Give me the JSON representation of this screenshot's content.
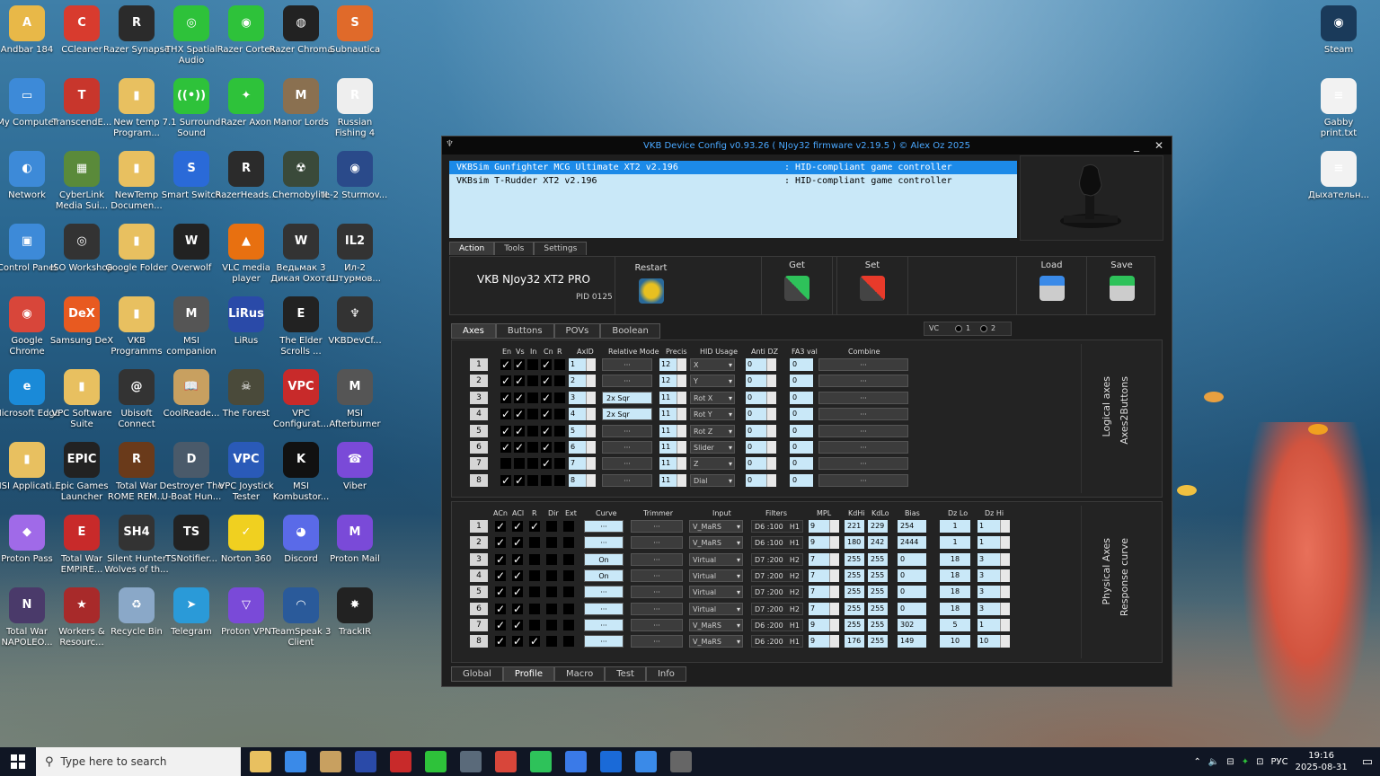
{
  "desktop": {
    "icons": [
      {
        "label": "Andbar 184",
        "color": "#e8b848",
        "glyph": "A"
      },
      {
        "label": "CCleaner",
        "color": "#d83b2e",
        "glyph": "C"
      },
      {
        "label": "Razer Synapse",
        "color": "#2b2b2b",
        "glyph": "R"
      },
      {
        "label": "THX Spatial Audio",
        "color": "#2ec23a",
        "glyph": "◎"
      },
      {
        "label": "Razer Cortex",
        "color": "#2ec23a",
        "glyph": "◉"
      },
      {
        "label": "Razer Chroma",
        "color": "#222",
        "glyph": "◍"
      },
      {
        "label": "Subnautica",
        "color": "#e06a2a",
        "glyph": "S"
      },
      {
        "label": "My Computer",
        "color": "#3d8ad8",
        "glyph": "▭"
      },
      {
        "label": "TranscendE...",
        "color": "#c8362c",
        "glyph": "T"
      },
      {
        "label": "New temp Program...",
        "color": "#e8c060",
        "glyph": "▮"
      },
      {
        "label": "7.1 Surround Sound",
        "color": "#2ec23a",
        "glyph": "((•))"
      },
      {
        "label": "Razer Axon",
        "color": "#2ec23a",
        "glyph": "✦"
      },
      {
        "label": "Manor Lords",
        "color": "#8a7050",
        "glyph": "M"
      },
      {
        "label": "Russian Fishing 4",
        "color": "#eee",
        "glyph": "R"
      },
      {
        "label": "Network",
        "color": "#3d8ad8",
        "glyph": "◐"
      },
      {
        "label": "CyberLink Media Sui...",
        "color": "#5a8a3a",
        "glyph": "▦"
      },
      {
        "label": "NewTemp Documen...",
        "color": "#e8c060",
        "glyph": "▮"
      },
      {
        "label": "Smart Switch",
        "color": "#2a6ad8",
        "glyph": "S"
      },
      {
        "label": "RazerHeads...",
        "color": "#2b2b2b",
        "glyph": "R"
      },
      {
        "label": "Chernobylite",
        "color": "#3a4a3a",
        "glyph": "☢"
      },
      {
        "label": "IL-2 Sturmov...",
        "color": "#2a4a8a",
        "glyph": "◉"
      },
      {
        "label": "Control Panel",
        "color": "#3d8ad8",
        "glyph": "▣"
      },
      {
        "label": "ISO Workshop",
        "color": "#333",
        "glyph": "◎"
      },
      {
        "label": "Google Folder",
        "color": "#e8c060",
        "glyph": "▮"
      },
      {
        "label": "Overwolf",
        "color": "#222",
        "glyph": "W"
      },
      {
        "label": "VLC media player",
        "color": "#e87010",
        "glyph": "▲"
      },
      {
        "label": "Ведьмак 3 Дикая Охота",
        "color": "#333",
        "glyph": "W"
      },
      {
        "label": "Ил-2 Штурмов...",
        "color": "#333",
        "glyph": "IL2"
      },
      {
        "label": "Google Chrome",
        "color": "#d8463a",
        "glyph": "◉"
      },
      {
        "label": "Samsung DeX",
        "color": "#e85a20",
        "glyph": "DeX"
      },
      {
        "label": "VKB Programms",
        "color": "#e8c060",
        "glyph": "▮"
      },
      {
        "label": "MSI companion",
        "color": "#555",
        "glyph": "M"
      },
      {
        "label": "LiRus",
        "color": "#2a4aa8",
        "glyph": "LiRus"
      },
      {
        "label": "The Elder Scrolls ...",
        "color": "#222",
        "glyph": "E"
      },
      {
        "label": "VKBDevCf...",
        "color": "#333",
        "glyph": "♆"
      },
      {
        "label": "Microsoft Edge",
        "color": "#1a8ad8",
        "glyph": "e"
      },
      {
        "label": "VPC Software Suite",
        "color": "#e8c060",
        "glyph": "▮"
      },
      {
        "label": "Ubisoft Connect",
        "color": "#333",
        "glyph": "@"
      },
      {
        "label": "CoolReade...",
        "color": "#c8a060",
        "glyph": "📖"
      },
      {
        "label": "The Forest",
        "color": "#4a4a3a",
        "glyph": "☠"
      },
      {
        "label": "VPC Configurat...",
        "color": "#c82a2a",
        "glyph": "VPC"
      },
      {
        "label": "MSI Afterburner",
        "color": "#555",
        "glyph": "M"
      },
      {
        "label": "MSI Applicati...",
        "color": "#e8c060",
        "glyph": "▮"
      },
      {
        "label": "Epic Games Launcher",
        "color": "#222",
        "glyph": "EPIC"
      },
      {
        "label": "Total War ROME REM...",
        "color": "#6a3a1a",
        "glyph": "R"
      },
      {
        "label": "Destroyer The U-Boat Hun...",
        "color": "#4a5a6a",
        "glyph": "D"
      },
      {
        "label": "VPC Joystick Tester",
        "color": "#2a5ab8",
        "glyph": "VPC"
      },
      {
        "label": "MSI Kombustor...",
        "color": "#111",
        "glyph": "K"
      },
      {
        "label": "Viber",
        "color": "#7a4ad8",
        "glyph": "☎"
      },
      {
        "label": "Proton Pass",
        "color": "#a06ae8",
        "glyph": "◆"
      },
      {
        "label": "Total War EMPIRE...",
        "color": "#c82a2a",
        "glyph": "E"
      },
      {
        "label": "Silent Hunter Wolves of th...",
        "color": "#333",
        "glyph": "SH4"
      },
      {
        "label": "TSNotifier...",
        "color": "#222",
        "glyph": "TS"
      },
      {
        "label": "Norton 360",
        "color": "#f0d020",
        "glyph": "✓"
      },
      {
        "label": "Discord",
        "color": "#5a6ae8",
        "glyph": "◕"
      },
      {
        "label": "Proton Mail",
        "color": "#7a4ad8",
        "glyph": "M"
      },
      {
        "label": "Total War NAPOLEO...",
        "color": "#4a3a6a",
        "glyph": "N"
      },
      {
        "label": "Workers & Resourc...",
        "color": "#a82a2a",
        "glyph": "★"
      },
      {
        "label": "Recycle Bin",
        "color": "#8aa8c8",
        "glyph": "♻"
      },
      {
        "label": "Telegram",
        "color": "#2a9ad8",
        "glyph": "➤"
      },
      {
        "label": "Proton VPN",
        "color": "#7a4ad8",
        "glyph": "▽"
      },
      {
        "label": "TeamSpeak 3 Client",
        "color": "#2a5a9a",
        "glyph": "◠"
      },
      {
        "label": "TrackIR",
        "color": "#222",
        "glyph": "✸"
      },
      {
        "label": "Steam",
        "color": "#1a3a5a",
        "glyph": "◉"
      },
      {
        "label": "Gabby print.txt",
        "color": "#f2f2f2",
        "glyph": "≡"
      },
      {
        "label": "Дыхательн...",
        "color": "#f2f2f2",
        "glyph": "≡"
      }
    ]
  },
  "window": {
    "title": "VKB Device Config v0.93.26 ( NJoy32 firmware v2.19.5 ) © Alex Oz 2025",
    "minimize": "_",
    "close": "✕",
    "devices": [
      {
        "name": "VKBSim Gunfighter MCG Ultimate XT2 v2.196",
        "type": ": HID-compliant game controller"
      },
      {
        "name": "VKBsim T-Rudder XT2 v2.196",
        "type": ": HID-compliant game controller"
      }
    ],
    "main_tabs": [
      "Action",
      "Tools",
      "Settings"
    ],
    "device_model": "VKB NJoy32 XT2 PRO",
    "pid": "PID 0125",
    "buttons": {
      "restart": "Restart",
      "get": "Get",
      "set": "Set",
      "load": "Load",
      "save": "Save"
    },
    "sub_tabs": [
      "Axes",
      "Buttons",
      "POVs",
      "Boolean"
    ],
    "vc": {
      "label": "VC",
      "opt1": "1",
      "opt2": "2"
    },
    "logical": {
      "headers": {
        "en": "En",
        "vs": "Vs",
        "in": "In",
        "cn": "Cn",
        "r": "R",
        "axid": "AxID",
        "relmode": "Relative Mode",
        "precis": "Precis",
        "hid": "HID Usage",
        "antidz": "Anti DZ",
        "fa3": "FA3 val",
        "combine": "Combine"
      },
      "side_label1": "Logical axes",
      "side_label2": "Axes2Buttons",
      "rows": [
        {
          "n": "1",
          "en": true,
          "vs": true,
          "in": false,
          "cn": true,
          "r": false,
          "axid": "1",
          "rel": "···",
          "precis": "12",
          "hid": "X",
          "antidz": "0",
          "fa3": "0",
          "combine": "···"
        },
        {
          "n": "2",
          "en": true,
          "vs": true,
          "in": false,
          "cn": true,
          "r": false,
          "axid": "2",
          "rel": "···",
          "precis": "12",
          "hid": "Y",
          "antidz": "0",
          "fa3": "0",
          "combine": "···"
        },
        {
          "n": "3",
          "en": true,
          "vs": true,
          "in": false,
          "cn": true,
          "r": false,
          "axid": "3",
          "rel": "2x  Sqr",
          "precis": "11",
          "hid": "Rot X",
          "antidz": "0",
          "fa3": "0",
          "combine": "···"
        },
        {
          "n": "4",
          "en": true,
          "vs": true,
          "in": false,
          "cn": true,
          "r": false,
          "axid": "4",
          "rel": "2x  Sqr",
          "precis": "11",
          "hid": "Rot Y",
          "antidz": "0",
          "fa3": "0",
          "combine": "···"
        },
        {
          "n": "5",
          "en": true,
          "vs": true,
          "in": false,
          "cn": true,
          "r": false,
          "axid": "5",
          "rel": "···",
          "precis": "11",
          "hid": "Rot Z",
          "antidz": "0",
          "fa3": "0",
          "combine": "···"
        },
        {
          "n": "6",
          "en": true,
          "vs": true,
          "in": false,
          "cn": true,
          "r": false,
          "axid": "6",
          "rel": "···",
          "precis": "11",
          "hid": "Slider",
          "antidz": "0",
          "fa3": "0",
          "combine": "···"
        },
        {
          "n": "7",
          "en": false,
          "vs": false,
          "in": false,
          "cn": true,
          "r": false,
          "axid": "7",
          "rel": "···",
          "precis": "11",
          "hid": "Z",
          "antidz": "0",
          "fa3": "0",
          "combine": "···"
        },
        {
          "n": "8",
          "en": true,
          "vs": true,
          "in": false,
          "cn": false,
          "r": false,
          "axid": "8",
          "rel": "···",
          "precis": "11",
          "hid": "Dial",
          "antidz": "0",
          "fa3": "0",
          "combine": "···"
        }
      ]
    },
    "physical": {
      "headers": {
        "acn": "ACn",
        "acl": "ACl",
        "r": "R",
        "dir": "Dir",
        "ext": "Ext",
        "curve": "Curve",
        "trimmer": "Trimmer",
        "input": "Input",
        "filters": "Filters",
        "mpl": "MPL",
        "kdhi": "KdHi",
        "kdlo": "KdLo",
        "bias": "Bias",
        "dzlo": "Dz Lo",
        "dzhi": "Dz Hi"
      },
      "side_label1": "Physical Axes",
      "side_label2": "Response curve",
      "rows": [
        {
          "n": "1",
          "acn": true,
          "acl": true,
          "r": true,
          "dir": false,
          "ext": false,
          "curve": "···",
          "trim": "···",
          "input": "V_MaRS",
          "filt": "D6 :100",
          "fh": "H1",
          "mpl": "9",
          "kdhi": "221",
          "kdlo": "229",
          "bias": "254",
          "dzlo": "1",
          "dzhi": "1"
        },
        {
          "n": "2",
          "acn": true,
          "acl": true,
          "r": false,
          "dir": false,
          "ext": false,
          "curve": "···",
          "trim": "···",
          "input": "V_MaRS",
          "filt": "D6 :100",
          "fh": "H1",
          "mpl": "9",
          "kdhi": "180",
          "kdlo": "242",
          "bias": "2444",
          "dzlo": "1",
          "dzhi": "1"
        },
        {
          "n": "3",
          "acn": true,
          "acl": true,
          "r": false,
          "dir": false,
          "ext": false,
          "curve": "On",
          "trim": "···",
          "input": "Virtual",
          "filt": "D7 :200",
          "fh": "H2",
          "mpl": "7",
          "kdhi": "255",
          "kdlo": "255",
          "bias": "0",
          "dzlo": "18",
          "dzhi": "3"
        },
        {
          "n": "4",
          "acn": true,
          "acl": true,
          "r": false,
          "dir": false,
          "ext": false,
          "curve": "On",
          "trim": "···",
          "input": "Virtual",
          "filt": "D7 :200",
          "fh": "H2",
          "mpl": "7",
          "kdhi": "255",
          "kdlo": "255",
          "bias": "0",
          "dzlo": "18",
          "dzhi": "3"
        },
        {
          "n": "5",
          "acn": true,
          "acl": true,
          "r": false,
          "dir": false,
          "ext": false,
          "curve": "···",
          "trim": "···",
          "input": "Virtual",
          "filt": "D7 :200",
          "fh": "H2",
          "mpl": "7",
          "kdhi": "255",
          "kdlo": "255",
          "bias": "0",
          "dzlo": "18",
          "dzhi": "3"
        },
        {
          "n": "6",
          "acn": true,
          "acl": true,
          "r": false,
          "dir": false,
          "ext": false,
          "curve": "···",
          "trim": "···",
          "input": "Virtual",
          "filt": "D7 :200",
          "fh": "H2",
          "mpl": "7",
          "kdhi": "255",
          "kdlo": "255",
          "bias": "0",
          "dzlo": "18",
          "dzhi": "3"
        },
        {
          "n": "7",
          "acn": true,
          "acl": true,
          "r": false,
          "dir": false,
          "ext": false,
          "curve": "···",
          "trim": "···",
          "input": "V_MaRS",
          "filt": "D6 :200",
          "fh": "H1",
          "mpl": "9",
          "kdhi": "255",
          "kdlo": "255",
          "bias": "302",
          "dzlo": "5",
          "dzhi": "1"
        },
        {
          "n": "8",
          "acn": true,
          "acl": true,
          "r": true,
          "dir": false,
          "ext": false,
          "curve": "···",
          "trim": "···",
          "input": "V_MaRS",
          "filt": "D6 :200",
          "fh": "H1",
          "mpl": "9",
          "kdhi": "176",
          "kdlo": "255",
          "bias": "149",
          "dzlo": "10",
          "dzhi": "10"
        }
      ]
    },
    "bottom_tabs": [
      "Global",
      "Profile",
      "Macro",
      "Test",
      "Info"
    ]
  },
  "taskbar": {
    "search_placeholder": "Type here to search",
    "apps": [
      {
        "name": "file-explorer",
        "color": "#e8c060"
      },
      {
        "name": "tasks",
        "color": "#3a8ae8"
      },
      {
        "name": "coolreader",
        "color": "#c8a060"
      },
      {
        "name": "lirus",
        "color": "#2a4aa8"
      },
      {
        "name": "total-war",
        "color": "#c82a2a"
      },
      {
        "name": "razer",
        "color": "#2ec23a"
      },
      {
        "name": "calculator",
        "color": "#5a6a7a"
      },
      {
        "name": "chrome",
        "color": "#d8463a"
      },
      {
        "name": "whatsapp",
        "color": "#2ec25a"
      },
      {
        "name": "messenger",
        "color": "#3a7ae8"
      },
      {
        "name": "outlook",
        "color": "#1a6ad8"
      },
      {
        "name": "store",
        "color": "#3a8ae8"
      },
      {
        "name": "vkb",
        "color": "#666"
      }
    ],
    "lang": "РУС",
    "time": "19:16",
    "date": "2025-08-31"
  }
}
